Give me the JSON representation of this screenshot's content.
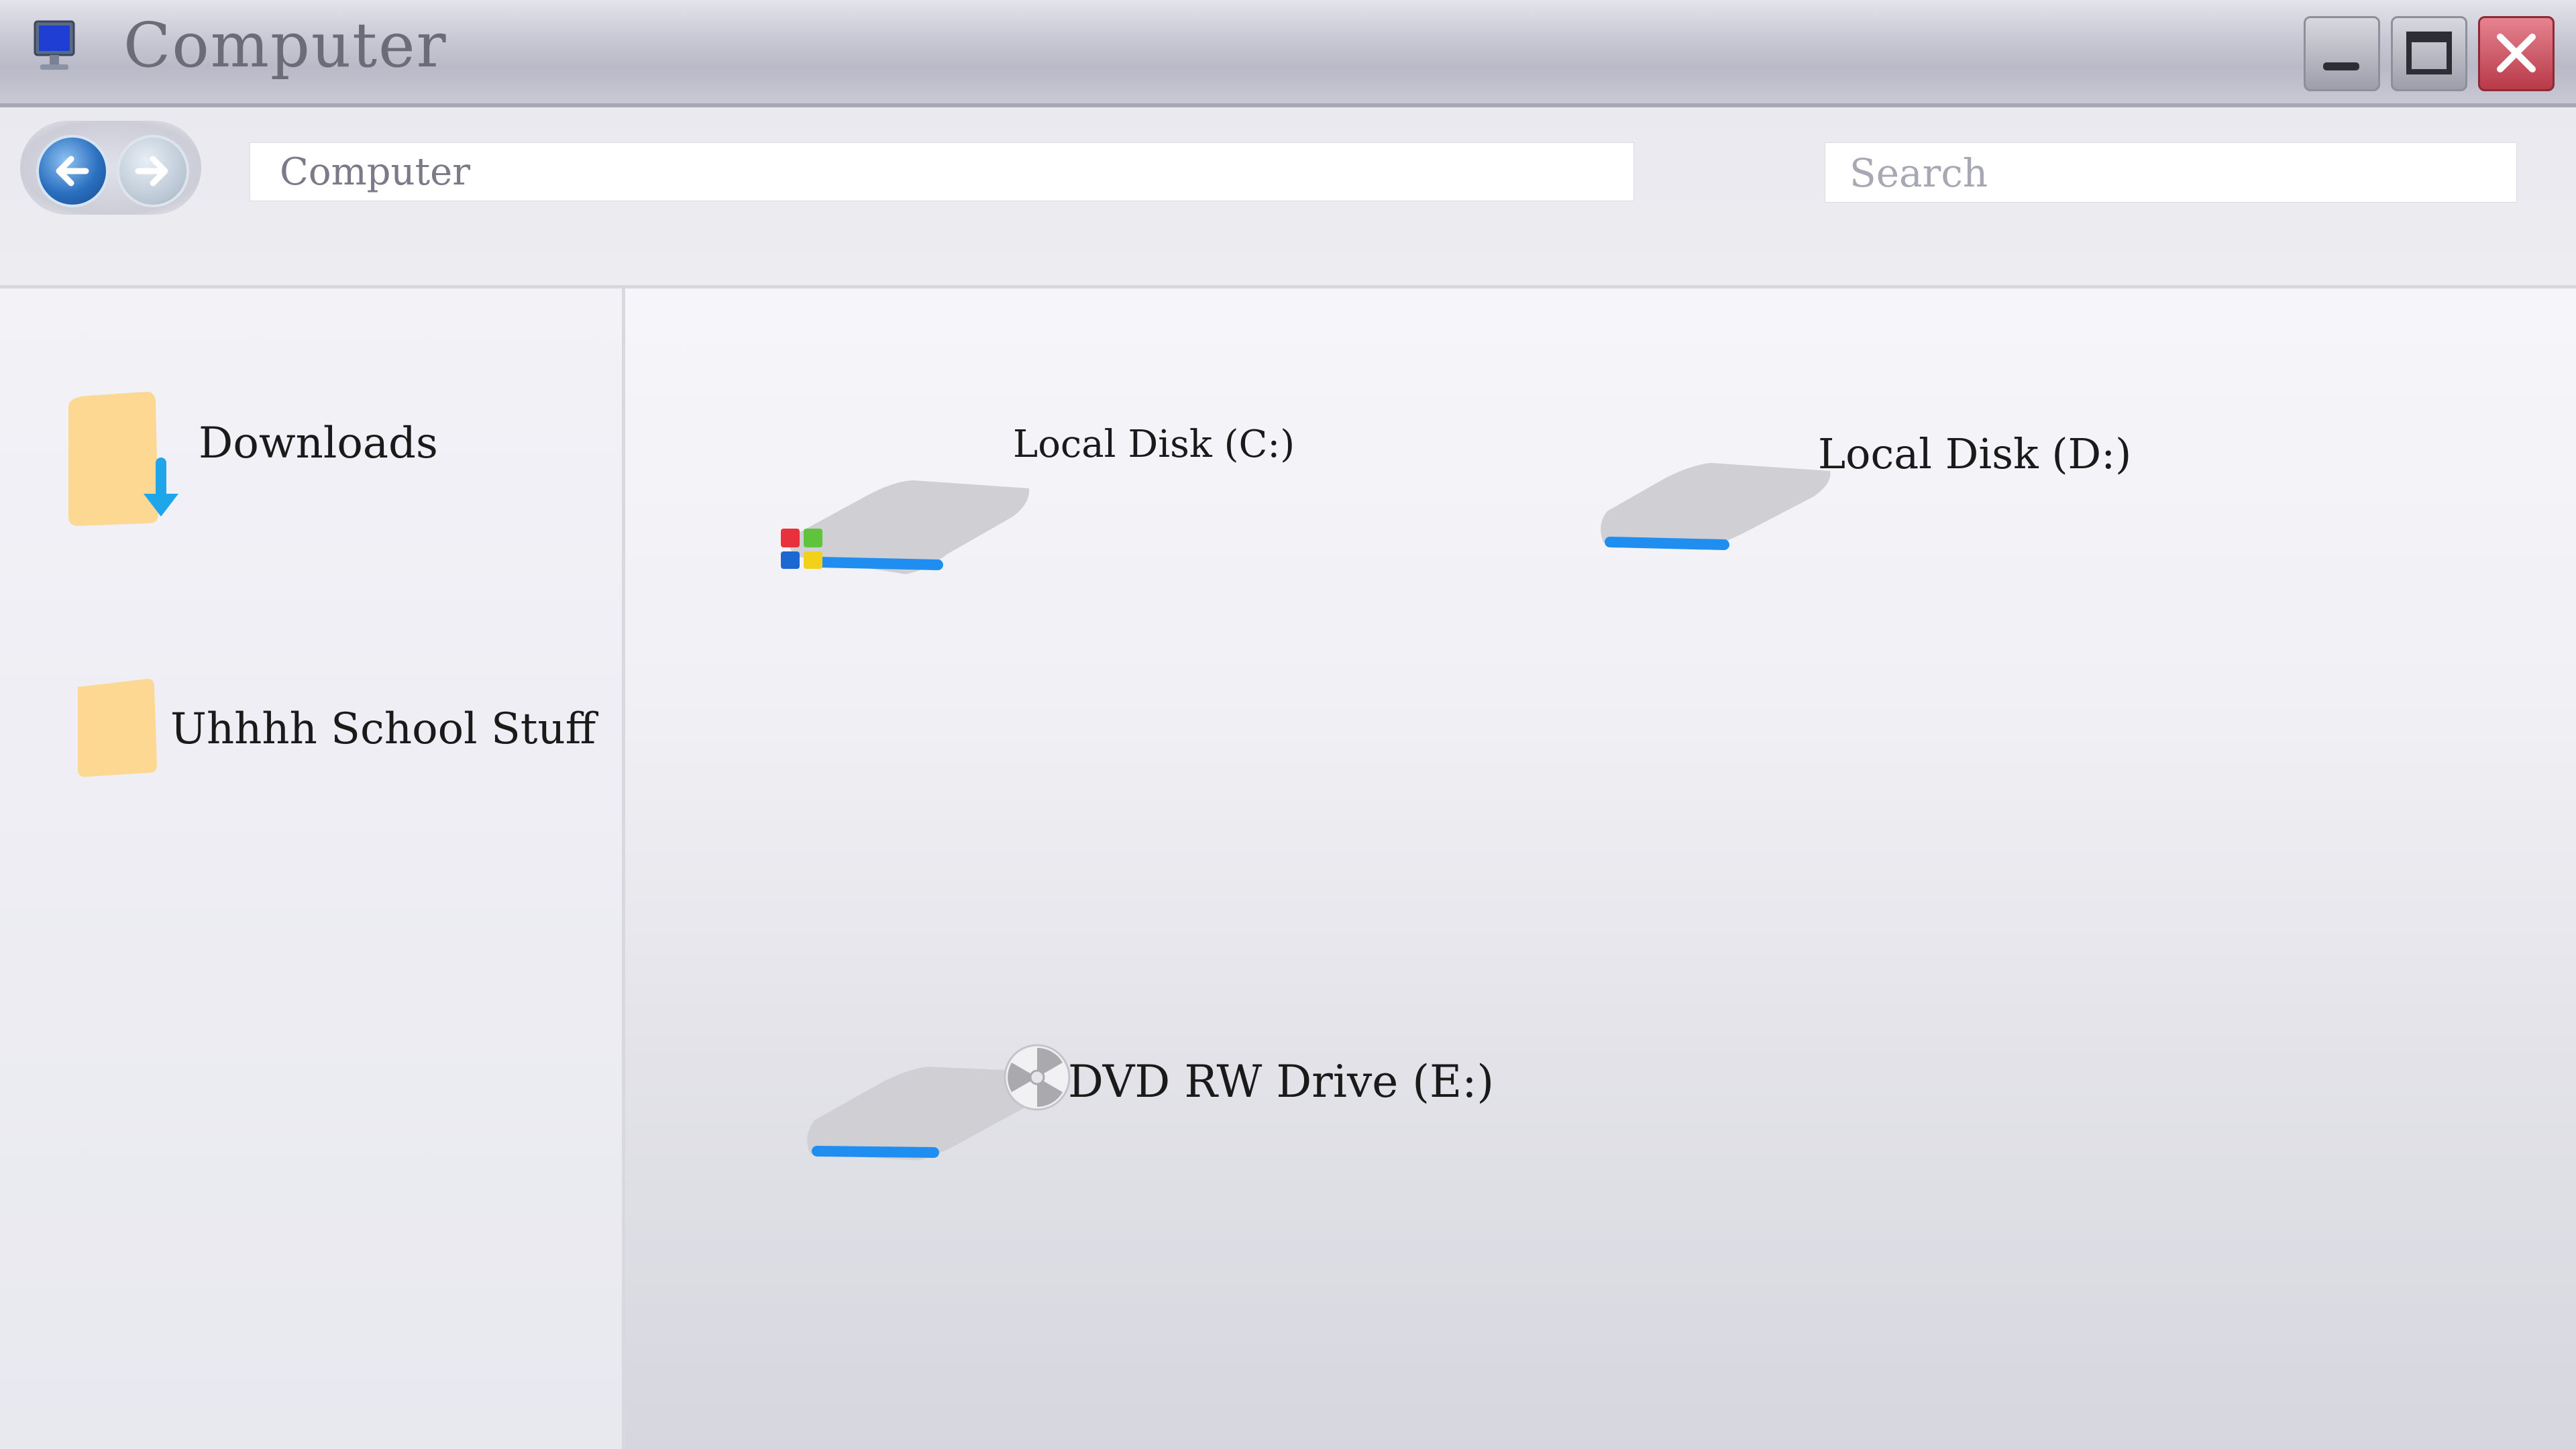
{
  "window": {
    "title": "Computer"
  },
  "toolbar": {
    "address": "Computer",
    "search_placeholder": "Search"
  },
  "sidebar": {
    "items": [
      {
        "label": "Downloads",
        "icon": "download-folder-icon"
      },
      {
        "label": "Uhhhh School Stuff",
        "icon": "folder-icon"
      }
    ]
  },
  "drives": [
    {
      "label": "Local Disk (C:)",
      "icon": "system-drive-icon"
    },
    {
      "label": "Local Disk (D:)",
      "icon": "hard-drive-icon"
    },
    {
      "label": "DVD RW Drive (E:)",
      "icon": "dvd-drive-icon"
    }
  ],
  "colors": {
    "accent_blue": "#1f8ef0",
    "folder_yellow": "#fcd892",
    "close_red": "#c94656"
  }
}
